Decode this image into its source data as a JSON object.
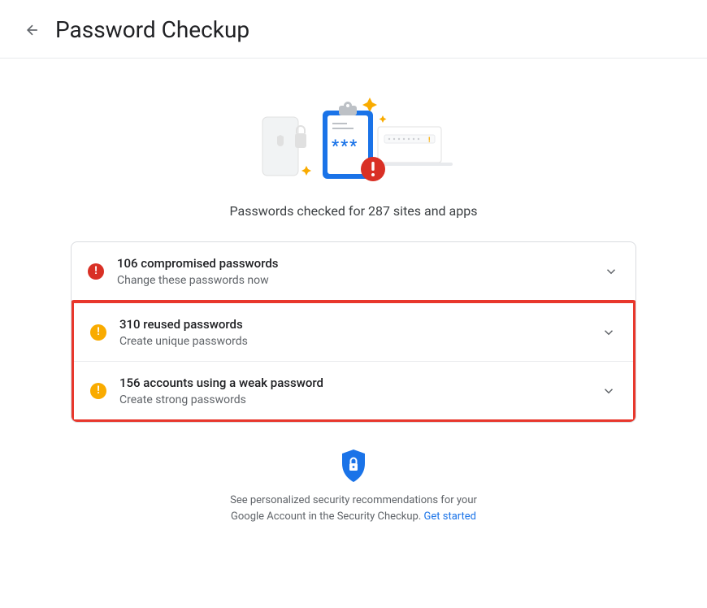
{
  "header": {
    "title": "Password Checkup"
  },
  "hero": {
    "checked_text": "Passwords checked for 287 sites and apps"
  },
  "rows": {
    "compromised": {
      "title": "106 compromised passwords",
      "sub": "Change these passwords now"
    },
    "reused": {
      "title": "310 reused passwords",
      "sub": "Create unique passwords"
    },
    "weak": {
      "title": "156 accounts using a weak password",
      "sub": "Create strong passwords"
    }
  },
  "footer": {
    "text_a": "See personalized security recommendations for your",
    "text_b": "Google Account in the Security Checkup. ",
    "link": "Get started"
  }
}
